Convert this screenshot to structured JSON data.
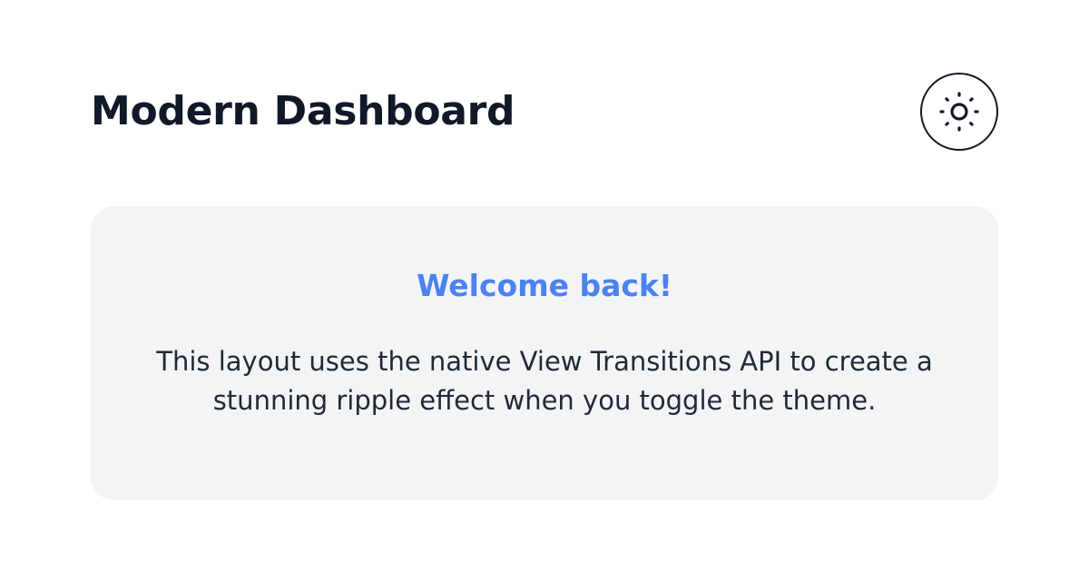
{
  "header": {
    "title": "Modern Dashboard",
    "toggle_icon": "sun-icon"
  },
  "card": {
    "title": "Welcome back!",
    "body": "This layout uses the native View Transitions API to create a stunning ripple effect when you toggle the theme."
  },
  "colors": {
    "accent": "#4b82f0",
    "text": "#111827",
    "card_background": "#f3f4f6",
    "page_background": "#ffffff"
  }
}
